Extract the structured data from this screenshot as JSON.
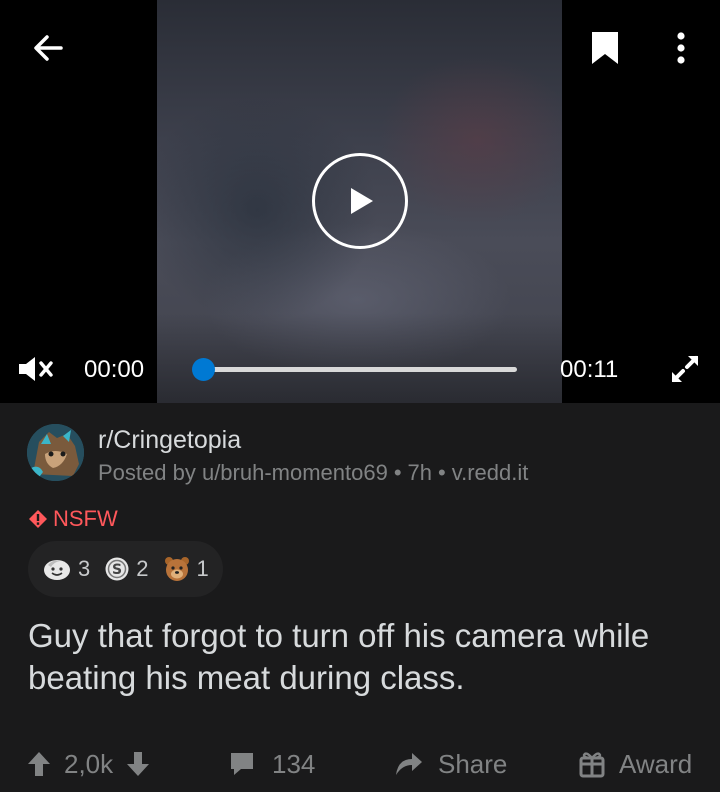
{
  "video": {
    "current_time": "00:00",
    "duration": "00:11",
    "progress": 0
  },
  "post": {
    "subreddit": "r/Cringetopia",
    "posted_by": "Posted by u/bruh-momento69",
    "age": "7h",
    "domain": "v.redd.it",
    "nsfw_label": "NSFW",
    "awards": [
      {
        "icon": "wholesome-award-icon",
        "count": "3"
      },
      {
        "icon": "silver-coin-award-icon",
        "count": "2"
      },
      {
        "icon": "bear-award-icon",
        "count": "1"
      }
    ],
    "title": "Guy that forgot to turn off his camera while beating his meat during class."
  },
  "actions": {
    "score": "2,0k",
    "comments": "134",
    "share_label": "Share",
    "award_label": "Award"
  },
  "colors": {
    "background": "#1a1a1b",
    "text": "#d7dadc",
    "muted": "#818384",
    "nsfw": "#ff585b",
    "seek_knob": "#0079d3"
  }
}
